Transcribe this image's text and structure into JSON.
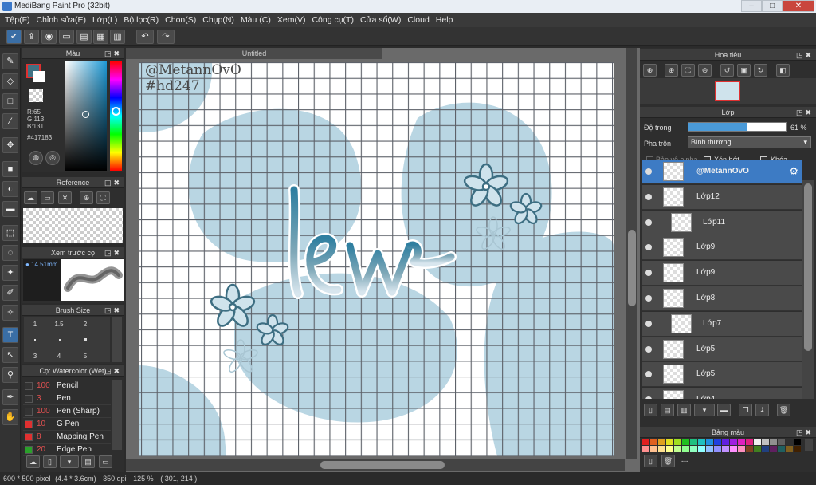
{
  "window": {
    "title": "MediBang Paint Pro (32bit)",
    "min": "–",
    "max": "□",
    "close": "✕"
  },
  "menu": [
    "Tệp(F)",
    "Chỉnh sửa(E)",
    "Lớp(L)",
    "Bộ lọc(R)",
    "Chọn(S)",
    "Chụp(N)",
    "Màu (C)",
    "Xem(V)",
    "Công cụ(T)",
    "Cửa sổ(W)",
    "Cloud",
    "Help"
  ],
  "colors": {
    "accent": "#3d7bc4",
    "current": "#417183",
    "blob": "#b9d6e3"
  },
  "color_panel": {
    "title": "Màu",
    "r": "R:65",
    "g": "G:113",
    "b": "B:131",
    "hex": "#417183"
  },
  "reference_panel": {
    "title": "Reference"
  },
  "brush_preview_panel": {
    "title": "Xem trước cọ",
    "size": "14.51mm"
  },
  "brush_size_panel": {
    "title": "Brush Size",
    "sizes": [
      "1",
      "1.5",
      "2",
      "3",
      "4",
      "5"
    ]
  },
  "brush_panel": {
    "title": "Cọ: Watercolor (Wet)",
    "brushes": [
      {
        "size": "100",
        "name": "Pencil",
        "color": "#333333"
      },
      {
        "size": "3",
        "name": "Pen",
        "color": "#333333"
      },
      {
        "size": "100",
        "name": "Pen (Sharp)",
        "color": "#333333"
      },
      {
        "size": "10",
        "name": "G Pen",
        "color": "#e03030"
      },
      {
        "size": "8",
        "name": "Mapping Pen",
        "color": "#e03030"
      },
      {
        "size": "20",
        "name": "Edge Pen",
        "color": "#2aa02a"
      }
    ]
  },
  "document": {
    "tab": "Untitled",
    "watermark_line1": "@MetannOvO",
    "watermark_line2": "#hd247",
    "art_text": "lew"
  },
  "navigator": {
    "title": "Hoa tiêu"
  },
  "layers_panel": {
    "title": "Lớp",
    "opacity_label": "Độ trong",
    "opacity_value": "61 %",
    "opacity": 0.61,
    "blend_label": "Pha trộn",
    "blend_value": "Bình thường",
    "protect_alpha": "Bảo vệ alpha",
    "clipping": "Xén bớt",
    "lock": "Khóa",
    "layers": [
      {
        "name": "@MetannOvO",
        "selected": true,
        "indent": false
      },
      {
        "name": "Lớp12",
        "selected": false,
        "indent": false
      },
      {
        "name": "Lớp11",
        "selected": false,
        "indent": true
      },
      {
        "name": "Lớp9",
        "selected": false,
        "indent": false
      },
      {
        "name": "Lớp9",
        "selected": false,
        "indent": false
      },
      {
        "name": "Lớp8",
        "selected": false,
        "indent": false
      },
      {
        "name": "Lớp7",
        "selected": false,
        "indent": true
      },
      {
        "name": "Lớp5",
        "selected": false,
        "indent": false
      },
      {
        "name": "Lớp5",
        "selected": false,
        "indent": false
      },
      {
        "name": "Lớp4",
        "selected": false,
        "indent": false
      }
    ]
  },
  "palette_panel": {
    "title": "Bảng màu",
    "swatches": [
      "#e02020",
      "#e06020",
      "#e0a020",
      "#e0e020",
      "#a0e020",
      "#20c020",
      "#20c080",
      "#20c0c0",
      "#2090e0",
      "#2040e0",
      "#6020e0",
      "#a020e0",
      "#e020c0",
      "#e02080",
      "#f0f0f0",
      "#c0c0c0",
      "#909090",
      "#606060",
      "#303030",
      "#000000",
      "#ff9090",
      "#ffc090",
      "#ffe090",
      "#ffff90",
      "#c0ff90",
      "#90ff90",
      "#90ffc0",
      "#90ffff",
      "#90c0ff",
      "#9090ff",
      "#c090ff",
      "#ff90ff",
      "#ff90c0",
      "#804020",
      "#408020",
      "#204080",
      "#602060",
      "#206060",
      "#806020",
      "#402000"
    ],
    "footer": "---"
  },
  "status": {
    "size": "600 * 500 pixel",
    "cm": "(4.4 * 3.6cm)",
    "dpi": "350 dpi",
    "zoom": "125 %",
    "coords": "( 301, 214 )"
  }
}
